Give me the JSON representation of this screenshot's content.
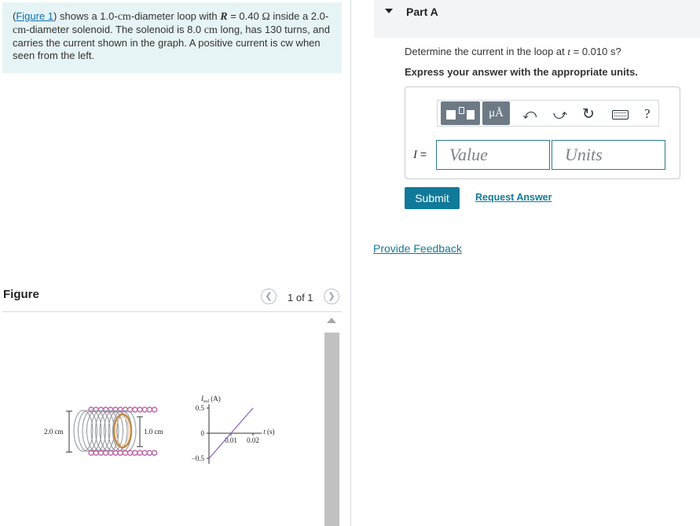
{
  "problem": {
    "figure_link": "Figure 1",
    "text_1": ") shows a 1.0-",
    "cm_1": "cm",
    "text_2": "-diameter loop with ",
    "r_var": "R",
    "text_3": " = 0.40 ",
    "ohm": "Ω",
    "text_4": " inside a 2.0-",
    "cm_2": "cm",
    "text_5": "-diameter solenoid. The solenoid is 8.0 ",
    "cm_3": "cm",
    "text_6": " long, has 130 turns, and carries the current shown in the graph. A positive current is cw when seen from the left."
  },
  "figure": {
    "title": "Figure",
    "page_indicator": "1 of 1",
    "prev_icon": "chevron-left-icon",
    "next_icon": "chevron-right-icon",
    "solenoid_diameter_label": "2.0 cm",
    "loop_diameter_label": "1.0 cm",
    "graph": {
      "y_axis_label": "I_sol (A)",
      "y_label_main": "I",
      "y_label_sub": "sol",
      "y_label_unit": " (A)",
      "x_axis_label": "t (s)",
      "x_label_var": "t",
      "x_label_unit": " (s)",
      "y_ticks": [
        "0.5",
        "0",
        "−0.5"
      ],
      "x_ticks": [
        "0.01",
        "0.02"
      ],
      "line_points": [
        [
          0,
          -0.5
        ],
        [
          0.02,
          0.5
        ]
      ]
    }
  },
  "part_a": {
    "label": "Part A",
    "question_prefix": "Determine the current in the loop at ",
    "question_var": "t",
    "question_suffix": " = 0.010 s?",
    "instructions": "Express your answer with the appropriate units.",
    "toolbar": {
      "templates_icon": "templates-icon",
      "units_label": "μÅ",
      "undo_icon": "undo-icon",
      "redo_icon": "redo-icon",
      "reset_icon": "reset-icon",
      "keyboard_icon": "keyboard-icon",
      "help_label": "?"
    },
    "variable": "I",
    "equals": "=",
    "value_placeholder": "Value",
    "units_placeholder": "Units",
    "submit_label": "Submit",
    "request_answer_label": "Request Answer"
  },
  "feedback_label": "Provide Feedback",
  "colors": {
    "problem_bg": "#e6f4f5",
    "link": "#0f6fb0",
    "accent": "#117a99",
    "toolbar_btn": "#6d7a85",
    "coil": "#c064a8",
    "loop": "#c08a4a"
  }
}
